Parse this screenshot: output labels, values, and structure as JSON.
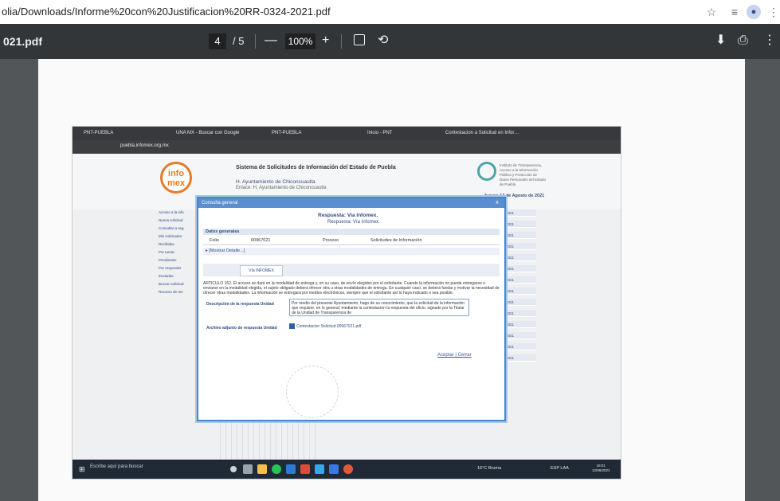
{
  "browser": {
    "url": "olia/Downloads/Informe%20con%20Justificacion%20RR-0324-2021.pdf",
    "icons": [
      "star-icon",
      "reading-list-icon",
      "profile-avatar",
      "more-icon"
    ]
  },
  "pdf_toolbar": {
    "title": "021.pdf",
    "current_page": "4",
    "page_separator": "/ 5",
    "zoom_out": "—",
    "zoom": "100%",
    "zoom_in": "+",
    "fit_icon": "fit-page-icon",
    "rotate_icon": "rotate-icon",
    "download": "⬇",
    "print": "⎙",
    "more": "⋮"
  },
  "scan": {
    "tabs": [
      "PNT-PUEBLA",
      "UNA MX - Buscar con Google",
      "PNT-PUEBLA",
      "Inicio - PNT",
      "Contestacion a Solicitud en Infor…"
    ],
    "address": "puebla.infomex.org.mx",
    "site_title": "Sistema de Solicitudes de Información del Estado de Puebla",
    "site_sub": "H. Ayuntamiento de Chiconcuautla",
    "site_sub2": "Enlace: H. Ayuntamiento de Chiconcuautla",
    "infomex": "info mex",
    "logo_text": "Instituto de Transparencia, Acceso a la Información Pública y Protección de Datos Personales del Estado de Puebla",
    "date": "Jueves 12 de Agosto de 2021",
    "left_menu": [
      "Acceso a la info",
      "Nueva solicitud",
      "Consultar a seg",
      "Mis solicitudes",
      "Recibidas",
      "Por turnar",
      "Pendientes",
      "Por responder",
      "Enviadas",
      "Buscar solicitud",
      "Recurso de rev"
    ],
    "right_menu": [
      "2021",
      "2021",
      "2021",
      "2021",
      "2021",
      "2021",
      "2021",
      "2021",
      "2021",
      "2021",
      "2021",
      "2021",
      "2021",
      "2021"
    ],
    "dialog": {
      "title": "Consulta general",
      "close": "x",
      "respuesta": "Respuesta: Vía Infomex.",
      "respuesta2": "Respuesta: Vía Infomex.",
      "section": "Datos generales",
      "folio_label": "Folio",
      "folio": "00967021",
      "proceso_label": "Proceso",
      "proceso": "Solicitudes de Información",
      "mostrar": "▸ [Mostrar Detalle...]",
      "tab": "Vía INFOMEX",
      "paragraph": "ARTICULO 162. El acceso se dará en la modalidad de entrega y, en su caso, de envío elegidos por el solicitante. Cuando la información no pueda entregarse o enviarse en la modalidad elegida, el sujeto obligado deberá ofrecer otra u otras modalidades de entrega. En cualquier caso, se deberá fundar y motivar la necesidad de ofrecer otras modalidades. La información se entregará por medios electrónicos, siempre que el solicitante así lo haya indicado o sea posible.",
      "desc_label": "Descripción de la respuesta Unidad",
      "desc_value": "Por medio del presente Ayuntamiento, hago de su conocimiento, que la solicitud de la información que requiere, en lo general, mediante la contestación la respuesta del oficio, signado por la Titular de la Unidad de Transparencia de",
      "file_label": "Archivo adjunto de respuesta Unidad",
      "file_name": "Contestacion Solicitud 00967021.pdf",
      "aceptar": "Aceptar",
      "cerrar": "Cerrar"
    },
    "taskbar": {
      "search": "Escribe aquí para buscar",
      "weather": "16°C Bruma",
      "lang": "ESP LAA",
      "time": "18:01",
      "date": "12/08/2021"
    }
  },
  "colors": {
    "toolbar": "#323639",
    "viewer": "#525659",
    "accent": "#4a86c8",
    "infomex_orange": "#e67a2a"
  }
}
